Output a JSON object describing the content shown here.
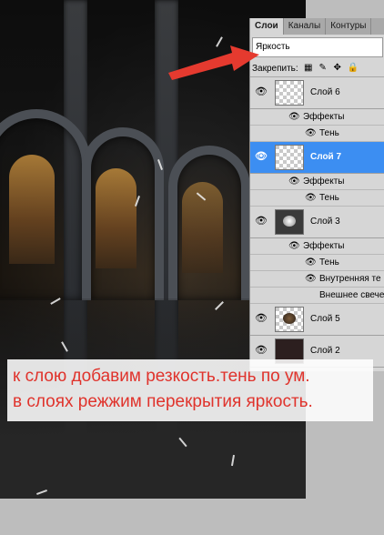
{
  "panel": {
    "tabs": [
      "Слои",
      "Каналы",
      "Контуры"
    ],
    "blend_mode": "Яркость",
    "lock_label": "Закрепить:",
    "layers": [
      {
        "name": "Слой 6",
        "effects_label": "Эффекты",
        "effects": [
          "Тень"
        ]
      },
      {
        "name": "Слой 7",
        "selected": true,
        "effects_label": "Эффекты",
        "effects": [
          "Тень"
        ]
      },
      {
        "name": "Слой 3",
        "effects_label": "Эффекты",
        "effects": [
          "Тень",
          "Внутренняя те",
          "Внешнее свече"
        ]
      },
      {
        "name": "Слой 5"
      },
      {
        "name": "Слой 2"
      }
    ]
  },
  "caption": {
    "line1": "к слою добавим резкость.тень по ум.",
    "line2": "в слоях режжим перекрытия яркость."
  },
  "colors": {
    "selection": "#3c8ef2",
    "caption_text": "#e0332c",
    "arrow": "#e53a2f"
  }
}
